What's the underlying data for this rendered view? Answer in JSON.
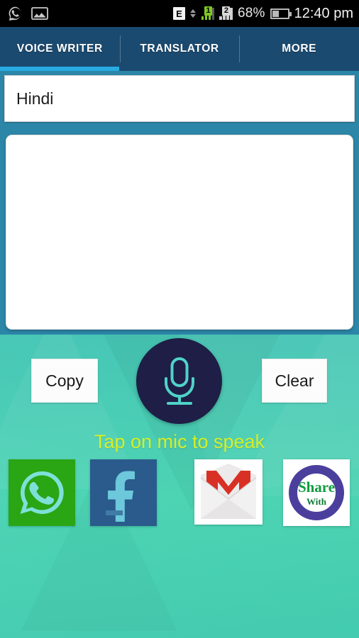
{
  "status_bar": {
    "left_icons": [
      "whatsapp-notification-icon",
      "gallery-image-icon"
    ],
    "network_type": "E",
    "sim1_label": "1",
    "sim2_label": "2",
    "battery_percent": "68%",
    "time": "12:40 pm"
  },
  "tabs": [
    {
      "label": "VOICE WRITER",
      "active": true
    },
    {
      "label": "TRANSLATOR",
      "active": false
    },
    {
      "label": "MORE",
      "active": false
    }
  ],
  "language_spinner": {
    "value": "Hindi",
    "name": "language-dropdown"
  },
  "text_area": {
    "value": "",
    "placeholder": ""
  },
  "actions": {
    "copy_label": "Copy",
    "clear_label": "Clear",
    "mic_icon": "microphone-icon"
  },
  "hint": {
    "text": "Tap on mic to speak"
  },
  "share_icons": [
    {
      "name": "whatsapp-share-icon",
      "label": "WhatsApp"
    },
    {
      "name": "facebook-share-icon",
      "label": "Facebook"
    },
    {
      "name": "gmail-share-icon",
      "label": "Gmail"
    },
    {
      "name": "share-with-icon",
      "label": "Share",
      "sub_label": "With"
    }
  ],
  "colors": {
    "tab_bar": "#1b4a70",
    "tab_indicator": "#29abe2",
    "panel_band": "#2c86a8",
    "background_teal": "#3fc2b5",
    "mic_circle": "#1e1e46",
    "mic_glyph": "#4fd3c8",
    "hint_yellow": "#d6ee28",
    "whatsapp_green": "#2aa514",
    "facebook_blue": "#2a5b8c",
    "gmail_red": "#d93025",
    "share_purple": "#4b3f9e",
    "share_green": "#0f9b3f"
  }
}
